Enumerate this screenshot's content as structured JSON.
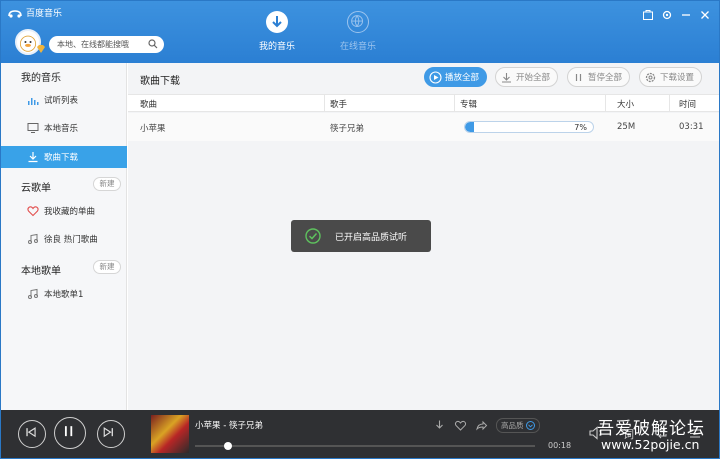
{
  "app": {
    "title": "百度音乐"
  },
  "search": {
    "placeholder": "本地、在线都能搜哦"
  },
  "nav": {
    "my_music": "我的音乐",
    "online_music": "在线音乐"
  },
  "sidebar": {
    "section_my": "我的音乐",
    "items_my": [
      {
        "label": "试听列表",
        "icon": "bars-icon"
      },
      {
        "label": "本地音乐",
        "icon": "monitor-icon"
      },
      {
        "label": "歌曲下载",
        "icon": "download-icon"
      }
    ],
    "section_cloud": "云歌单",
    "new_label": "新建",
    "items_cloud": [
      {
        "label": "我收藏的单曲",
        "icon": "heart-icon"
      },
      {
        "label": "徐良 热门歌曲",
        "icon": "music-note-icon"
      }
    ],
    "section_local": "本地歌单",
    "items_local": [
      {
        "label": "本地歌单1",
        "icon": "music-note-icon"
      }
    ]
  },
  "main": {
    "title": "歌曲下载",
    "buttons": {
      "play_all": "播放全部",
      "start_all": "开始全部",
      "pause_all": "暂停全部",
      "settings": "下载设置"
    },
    "columns": {
      "song": "歌曲",
      "artist": "歌手",
      "album": "专辑",
      "size": "大小",
      "time": "时间"
    },
    "rows": [
      {
        "song": "小苹果",
        "artist": "筷子兄弟",
        "progress": 0.07,
        "progress_text": "7%",
        "size": "25M",
        "time": "03:31"
      }
    ]
  },
  "toast": {
    "text": "已开启高品质试听"
  },
  "player": {
    "now_playing": "小苹果 - 筷子兄弟",
    "quality": "高品质",
    "elapsed": "00:18",
    "progress": 0.085
  },
  "watermark": {
    "line1": "吾爱破解论坛",
    "line2": "www.52pojie.cn"
  },
  "colors": {
    "accent": "#3f9ae6",
    "titlebar": "#2b7fd3",
    "player_bg": "#2f3033"
  }
}
